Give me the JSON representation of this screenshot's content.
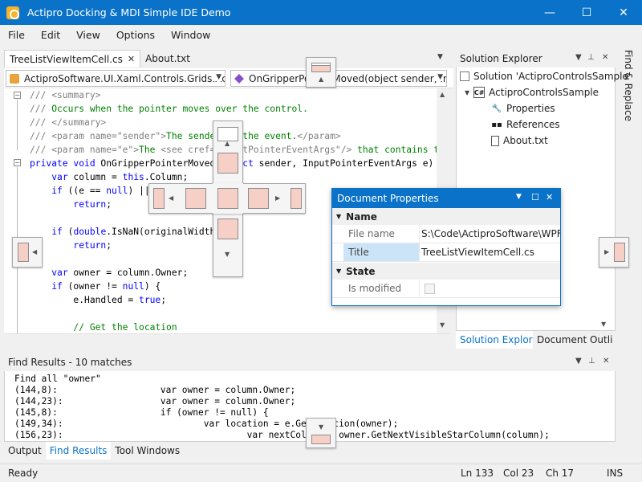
{
  "window": {
    "title": "Actipro Docking & MDI Simple IDE Demo",
    "minimize": "—",
    "maximize": "☐",
    "close": "✕"
  },
  "menu": [
    "File",
    "Edit",
    "View",
    "Options",
    "Window"
  ],
  "doc_tabs": [
    {
      "label": "TreeListViewItemCell.cs",
      "active": true,
      "close": "✕"
    },
    {
      "label": "About.txt",
      "active": false
    }
  ],
  "nav": {
    "type_combo": "ActiproSoftware.UI.Xaml.Controls.Grids.ActiproSoftware",
    "member_combo": "OnGripperPointerMoved(object sender, InputPointerEventArgs e)"
  },
  "code": [
    {
      "t": [
        [
          "c-gray",
          "/// <summary>"
        ]
      ]
    },
    {
      "t": [
        [
          "c-gray",
          "/// "
        ],
        [
          "c-green",
          "Occurs when the pointer moves over the control."
        ]
      ]
    },
    {
      "t": [
        [
          "c-gray",
          "/// </summary>"
        ]
      ]
    },
    {
      "t": [
        [
          "c-gray",
          "/// <param name=\"sender\">"
        ],
        [
          "c-green",
          "The sender of the event."
        ],
        [
          "c-gray",
          "</param>"
        ]
      ]
    },
    {
      "t": [
        [
          "c-gray",
          "/// <param name=\"e\">"
        ],
        [
          "c-green",
          "The "
        ],
        [
          "c-gray",
          "<see cref=\"InputPointerEventArgs\"/>"
        ],
        [
          "c-green",
          " that contains the"
        ]
      ]
    },
    {
      "t": [
        [
          "c-blue",
          "private void "
        ],
        [
          "c-black",
          "OnGripperPointerMoved("
        ],
        [
          "c-blue",
          "object"
        ],
        [
          "c-black",
          " sender, InputPointerEventArgs e) {"
        ]
      ]
    },
    {
      "t": [
        [
          "c-black",
          "    "
        ],
        [
          "c-blue",
          "var"
        ],
        [
          "c-black",
          " column = "
        ],
        [
          "c-blue",
          "this"
        ],
        [
          "c-black",
          ".Column;"
        ]
      ]
    },
    {
      "t": [
        [
          "c-black",
          "    "
        ],
        [
          "c-blue",
          "if"
        ],
        [
          "c-black",
          " ((e == "
        ],
        [
          "c-blue",
          "null"
        ],
        [
          "c-black",
          ") || (column == null))"
        ]
      ]
    },
    {
      "t": [
        [
          "c-black",
          "        "
        ],
        [
          "c-blue",
          "return"
        ],
        [
          "c-black",
          ";"
        ]
      ]
    },
    {
      "t": [
        [
          "c-black",
          ""
        ]
      ]
    },
    {
      "t": [
        [
          "c-black",
          "    "
        ],
        [
          "c-blue",
          "if"
        ],
        [
          "c-black",
          " ("
        ],
        [
          "c-blue",
          "double"
        ],
        [
          "c-black",
          ".IsNaN(originalWidth))"
        ]
      ]
    },
    {
      "t": [
        [
          "c-black",
          "        "
        ],
        [
          "c-blue",
          "return"
        ],
        [
          "c-black",
          ";"
        ]
      ]
    },
    {
      "t": [
        [
          "c-black",
          ""
        ]
      ]
    },
    {
      "t": [
        [
          "c-black",
          "    "
        ],
        [
          "c-blue",
          "var"
        ],
        [
          "c-black",
          " owner = column.Owner;"
        ]
      ]
    },
    {
      "t": [
        [
          "c-black",
          "    "
        ],
        [
          "c-blue",
          "if"
        ],
        [
          "c-black",
          " (owner != "
        ],
        [
          "c-blue",
          "null"
        ],
        [
          "c-black",
          ") {"
        ]
      ]
    },
    {
      "t": [
        [
          "c-black",
          "        e.Handled = "
        ],
        [
          "c-blue",
          "true"
        ],
        [
          "c-black",
          ";"
        ]
      ]
    },
    {
      "t": [
        [
          "c-black",
          ""
        ]
      ]
    },
    {
      "t": [
        [
          "c-black",
          "        "
        ],
        [
          "c-green",
          "// Get the location"
        ]
      ]
    }
  ],
  "solution_explorer": {
    "title": "Solution Explorer",
    "items": [
      {
        "label": "Solution 'ActiproControlsSample'",
        "icon": "solution-icon"
      },
      {
        "label": "ActiproControlsSample",
        "icon": "csharp-project-icon",
        "badge": "C#"
      },
      {
        "label": "Properties",
        "icon": "wrench-icon"
      },
      {
        "label": "References",
        "icon": "references-icon"
      },
      {
        "label": "About.txt",
        "icon": "text-file-icon"
      }
    ],
    "tabs": [
      "Solution Explorer",
      "Document Outline"
    ]
  },
  "find_replace_label": "Find & Replace",
  "find_results": {
    "title": "Find Results - 10 matches",
    "lines": [
      "Find all \"owner\"",
      "(144,8):                   var owner = column.Owner;",
      "(144,23):                  var owner = column.Owner;",
      "(145,8):                   if (owner != null) {",
      "(149,34):                          var location = e.GetPosition(owner);",
      "(156,23):                                  var nextColumn = owner.GetNextVisibleStarColumn(column);"
    ]
  },
  "bottom_tabs": [
    "Output",
    "Find Results",
    "Tool Windows"
  ],
  "status": {
    "ready": "Ready",
    "ln": "Ln 133",
    "col": "Col 23",
    "ch": "Ch 17",
    "mode": "INS"
  },
  "doc_properties": {
    "title": "Document Properties",
    "categories": [
      {
        "name": "Name",
        "rows": [
          {
            "name": "File name",
            "value": "S:\\Code\\ActiproSoftware\\WPF-Controls"
          },
          {
            "name": "Title",
            "value": "TreeListViewItemCell.cs"
          }
        ]
      },
      {
        "name": "State",
        "rows": [
          {
            "name": "Is modified",
            "value": ""
          }
        ]
      }
    ]
  },
  "colors": {
    "accent": "#0a73c9",
    "guide_fill": "#f6cfc7"
  }
}
